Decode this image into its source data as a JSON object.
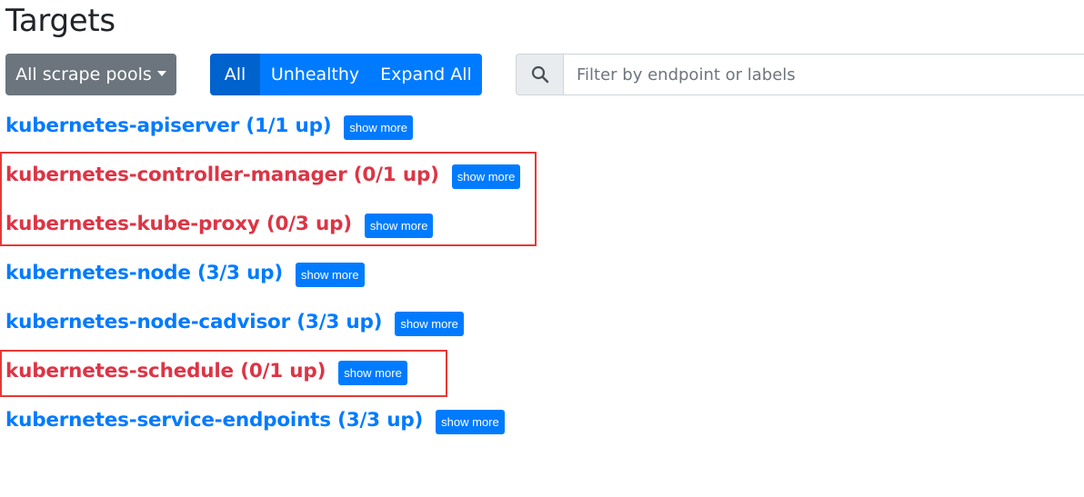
{
  "page": {
    "title": "Targets"
  },
  "toolbar": {
    "pools_dropdown_label": "All scrape pools",
    "filter_all_label": "All",
    "filter_unhealthy_label": "Unhealthy",
    "expand_all_label": "Expand All",
    "search_placeholder": "Filter by endpoint or labels",
    "search_value": ""
  },
  "pools": [
    {
      "name": "kubernetes-apiserver (1/1 up)",
      "status": "up",
      "button": "show more"
    },
    {
      "name": "kubernetes-controller-manager (0/1 up)",
      "status": "down",
      "button": "show more"
    },
    {
      "name": "kubernetes-kube-proxy (0/3 up)",
      "status": "down",
      "button": "show more"
    },
    {
      "name": "kubernetes-node (3/3 up)",
      "status": "up",
      "button": "show more"
    },
    {
      "name": "kubernetes-node-cadvisor (3/3 up)",
      "status": "up",
      "button": "show more"
    },
    {
      "name": "kubernetes-schedule (0/1 up)",
      "status": "down",
      "button": "show more"
    },
    {
      "name": "kubernetes-service-endpoints (3/3 up)",
      "status": "up",
      "button": "show more"
    }
  ],
  "colors": {
    "up": "#007bff",
    "down": "#dc3545",
    "highlight_border": "#e53935"
  },
  "icons": {
    "search": "search-icon",
    "dropdown": "caret-down-icon"
  }
}
